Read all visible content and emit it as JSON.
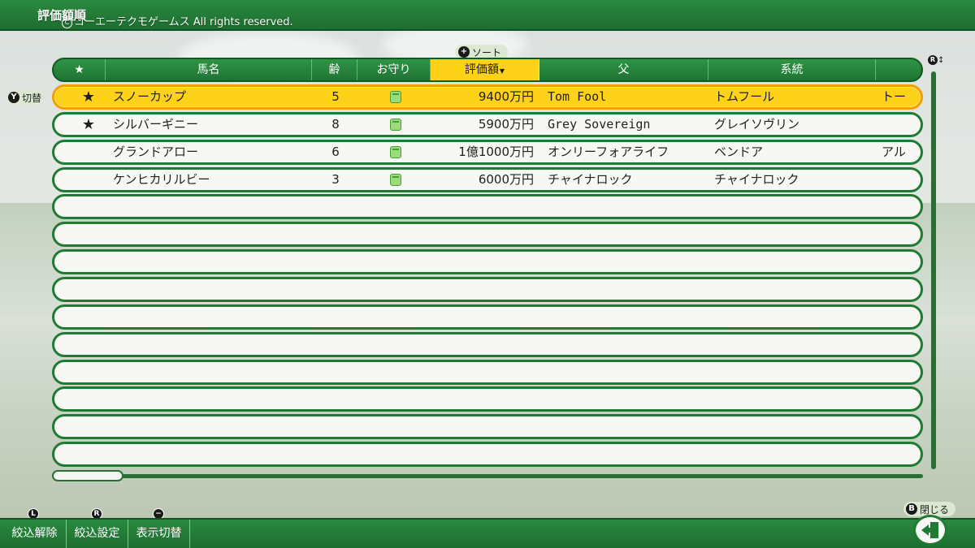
{
  "header": {
    "title": "評価額順",
    "copyright_symbol": "C",
    "copyright": "コーエーテクモゲームス All rights reserved."
  },
  "sort_hint": {
    "button": "+",
    "label": "ソート"
  },
  "toggle_hint": {
    "button": "Y",
    "label": "切替"
  },
  "scroll_hint": {
    "button": "R",
    "arrows": "↕"
  },
  "columns": {
    "fav": "★",
    "name": "馬名",
    "age": "齢",
    "charm": "お守り",
    "value": "評価額",
    "value_sort_marker": "▼",
    "sire": "父",
    "line": "系統"
  },
  "rows": [
    {
      "fav": "★",
      "name": "スノーカップ",
      "age": "5",
      "charm": true,
      "value": "9400万円",
      "sire": "Tom Fool",
      "line": "トムフール",
      "extra": "トー",
      "selected": true
    },
    {
      "fav": "★",
      "name": "シルバーギニー",
      "age": "8",
      "charm": true,
      "value": "5900万円",
      "sire": "Grey Sovereign",
      "line": "グレイソヴリン",
      "extra": "",
      "selected": false
    },
    {
      "fav": "",
      "name": "グランドアロー",
      "age": "6",
      "charm": true,
      "value": "1億1000万円",
      "sire": "オンリーフォアライフ",
      "line": "ベンドア",
      "extra": "アル",
      "selected": false
    },
    {
      "fav": "",
      "name": "ケンヒカリルビー",
      "age": "3",
      "charm": true,
      "value": "6000万円",
      "sire": "チャイナロック",
      "line": "チャイナロック",
      "extra": "",
      "selected": false
    }
  ],
  "empty_rows": 10,
  "bottom": {
    "release_key": "L",
    "release_label": "絞込解除",
    "settings_key": "R",
    "settings_label": "絞込設定",
    "display_key": "−",
    "display_label": "表示切替",
    "close_key": "B",
    "close_label": "閉じる"
  },
  "colors": {
    "accent_green": "#1f7a33",
    "highlight_yellow": "#ffd21a",
    "charm_green": "#9bdc7a"
  }
}
